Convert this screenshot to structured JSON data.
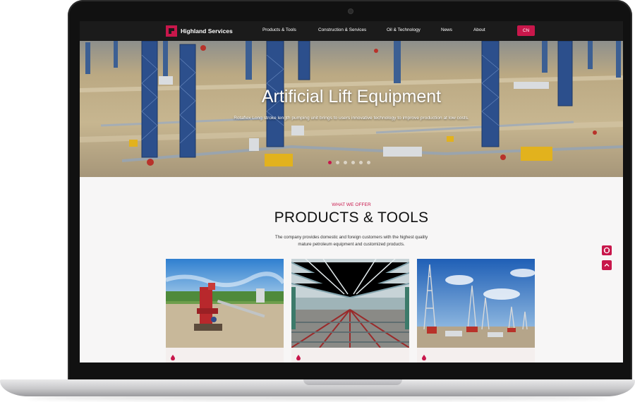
{
  "site": {
    "brand": "Highland Services",
    "nav": [
      {
        "label": "Products & Tools"
      },
      {
        "label": "Construction & Services"
      },
      {
        "label": "Oil & Technology"
      },
      {
        "label": "News"
      },
      {
        "label": "About"
      }
    ],
    "lang_button": "CN"
  },
  "hero": {
    "title": "Artificial Lift Equipment",
    "subtitle": "Rotaflex Long stroke length pumping unit brings to users innovative technology to improve production at low costs.",
    "slides": 6,
    "active_slide": 1
  },
  "section": {
    "eyebrow": "WHAT WE OFFER",
    "title": "PRODUCTS & TOOLS",
    "description_line1": "The company provides domestic and foreign customers with the highest quality",
    "description_line2": "mature petroleum equipment and customized products."
  },
  "side_buttons": [
    {
      "icon": "support-icon"
    },
    {
      "icon": "arrow-up-icon"
    }
  ],
  "cards": [
    {
      "image": "wellhead-photo",
      "icon": "oil-drop-icon"
    },
    {
      "image": "factory-hall-photo",
      "icon": "oil-drop-icon"
    },
    {
      "image": "drilling-rigs-photo",
      "icon": "oil-drop-icon"
    }
  ],
  "colors": {
    "accent": "#c8174b",
    "nav_bg": "#1b1b1b",
    "page_bg": "#f7f6f6"
  }
}
